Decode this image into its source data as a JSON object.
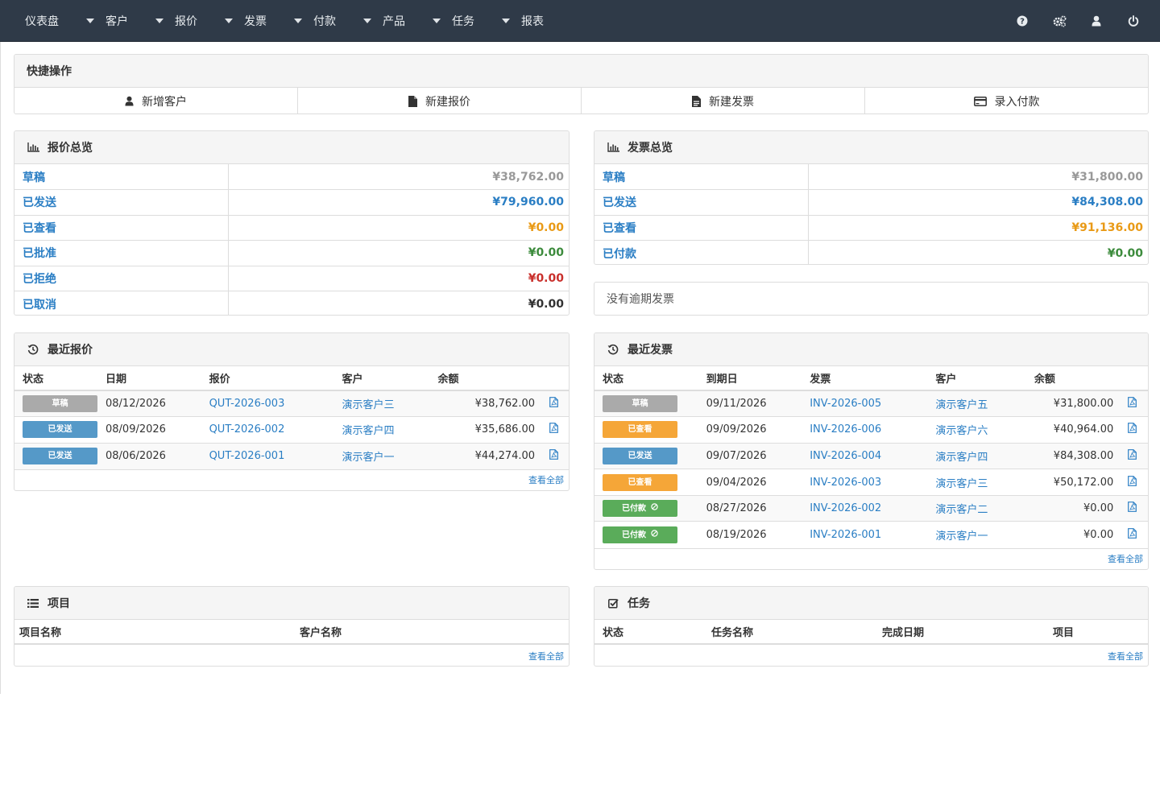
{
  "nav": {
    "items": [
      "仪表盘",
      "客户",
      "报价",
      "发票",
      "付款",
      "产品",
      "任务",
      "报表"
    ],
    "icons": [
      "help-icon",
      "settings-icon",
      "user-icon",
      "power-icon"
    ]
  },
  "quick": {
    "title": "快捷操作",
    "buttons": [
      {
        "label": "新增客户",
        "icon": "user-icon"
      },
      {
        "label": "新建报价",
        "icon": "file-icon"
      },
      {
        "label": "新建发票",
        "icon": "file-text-icon"
      },
      {
        "label": "录入付款",
        "icon": "credit-card-icon"
      }
    ]
  },
  "quote_summary": {
    "title": "报价总览",
    "rows": [
      {
        "label": "草稿",
        "value": "¥38,762.00",
        "color": "#999999"
      },
      {
        "label": "已发送",
        "value": "¥79,960.00",
        "color": "#2a7ec4"
      },
      {
        "label": "已查看",
        "value": "¥0.00",
        "color": "#e99a16"
      },
      {
        "label": "已批准",
        "value": "¥0.00",
        "color": "#3c8b3c"
      },
      {
        "label": "已拒绝",
        "value": "¥0.00",
        "color": "#c9302c"
      },
      {
        "label": "已取消",
        "value": "¥0.00",
        "color": "#333333"
      }
    ]
  },
  "invoice_summary": {
    "title": "发票总览",
    "rows": [
      {
        "label": "草稿",
        "value": "¥31,800.00",
        "color": "#999999"
      },
      {
        "label": "已发送",
        "value": "¥84,308.00",
        "color": "#2a7ec4"
      },
      {
        "label": "已查看",
        "value": "¥91,136.00",
        "color": "#e99a16"
      },
      {
        "label": "已付款",
        "value": "¥0.00",
        "color": "#3c8b3c"
      }
    ],
    "overdue_note": "没有逾期发票"
  },
  "recent_quotes": {
    "title": "最近报价",
    "headers": [
      "状态",
      "日期",
      "报价",
      "客户",
      "余额"
    ],
    "rows": [
      {
        "status": "草稿",
        "status_color": "#aaaaaa",
        "date": "08/12/2026",
        "number": "QUT-2026-003",
        "client": "演示客户三",
        "amount": "¥38,762.00"
      },
      {
        "status": "已发送",
        "status_color": "#5599c8",
        "date": "08/09/2026",
        "number": "QUT-2026-002",
        "client": "演示客户四",
        "amount": "¥35,686.00"
      },
      {
        "status": "已发送",
        "status_color": "#5599c8",
        "date": "08/06/2026",
        "number": "QUT-2026-001",
        "client": "演示客户一",
        "amount": "¥44,274.00"
      }
    ],
    "view_all": "查看全部"
  },
  "recent_invoices": {
    "title": "最近发票",
    "headers": [
      "状态",
      "到期日",
      "发票",
      "客户",
      "余额"
    ],
    "rows": [
      {
        "status": "草稿",
        "status_color": "#aaaaaa",
        "date": "09/11/2026",
        "number": "INV-2026-005",
        "client": "演示客户五",
        "amount": "¥31,800.00"
      },
      {
        "status": "已查看",
        "status_color": "#f5a638",
        "date": "09/09/2026",
        "number": "INV-2026-006",
        "client": "演示客户六",
        "amount": "¥40,964.00"
      },
      {
        "status": "已发送",
        "status_color": "#5599c8",
        "date": "09/07/2026",
        "number": "INV-2026-004",
        "client": "演示客户四",
        "amount": "¥84,308.00"
      },
      {
        "status": "已查看",
        "status_color": "#f5a638",
        "date": "09/04/2026",
        "number": "INV-2026-003",
        "client": "演示客户三",
        "amount": "¥50,172.00"
      },
      {
        "status": "已付款",
        "status_color": "#5aac5a",
        "date": "08/27/2026",
        "number": "INV-2026-002",
        "client": "演示客户二",
        "amount": "¥0.00",
        "paid": true
      },
      {
        "status": "已付款",
        "status_color": "#5aac5a",
        "date": "08/19/2026",
        "number": "INV-2026-001",
        "client": "演示客户一",
        "amount": "¥0.00",
        "paid": true
      }
    ],
    "view_all": "查看全部"
  },
  "projects": {
    "title": "项目",
    "headers": [
      "项目名称",
      "客户名称"
    ],
    "view_all": "查看全部"
  },
  "tasks": {
    "title": "任务",
    "headers": [
      "状态",
      "任务名称",
      "完成日期",
      "项目"
    ],
    "view_all": "查看全部"
  }
}
